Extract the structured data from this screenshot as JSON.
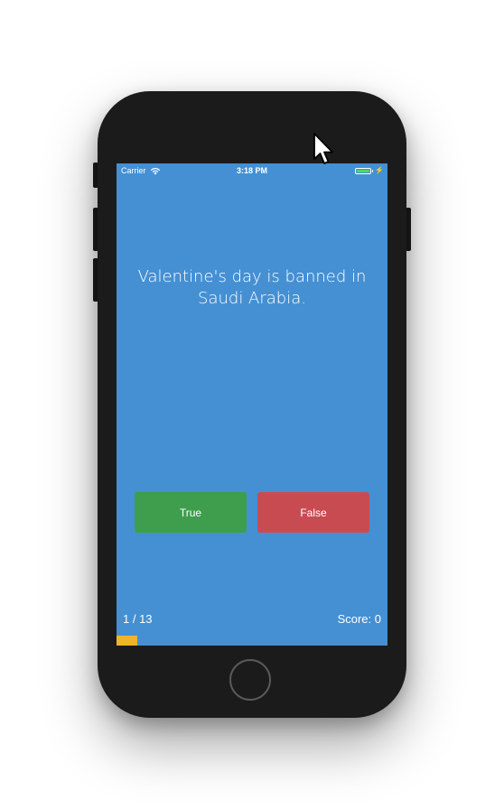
{
  "status_bar": {
    "carrier": "Carrier",
    "time": "3:18 PM",
    "battery_color": "#4cd964",
    "battery_level": 1.0
  },
  "quiz": {
    "question": "Valentine's day is banned in Saudi Arabia.",
    "true_label": "True",
    "false_label": "False",
    "progress_text": "1 / 13",
    "score_text": "Score: 0",
    "current_question": 1,
    "total_questions": 13
  },
  "colors": {
    "screen_background": "#4590d3",
    "true_button": "#3e9e4d",
    "false_button": "#c94b52",
    "progress_bar": "#f0b429",
    "phone_body": "#1b1b1b"
  },
  "icons": {
    "wifi": "wifi-icon",
    "battery": "battery-icon",
    "charging": "bolt-icon",
    "cursor": "pointer-cursor-icon"
  }
}
